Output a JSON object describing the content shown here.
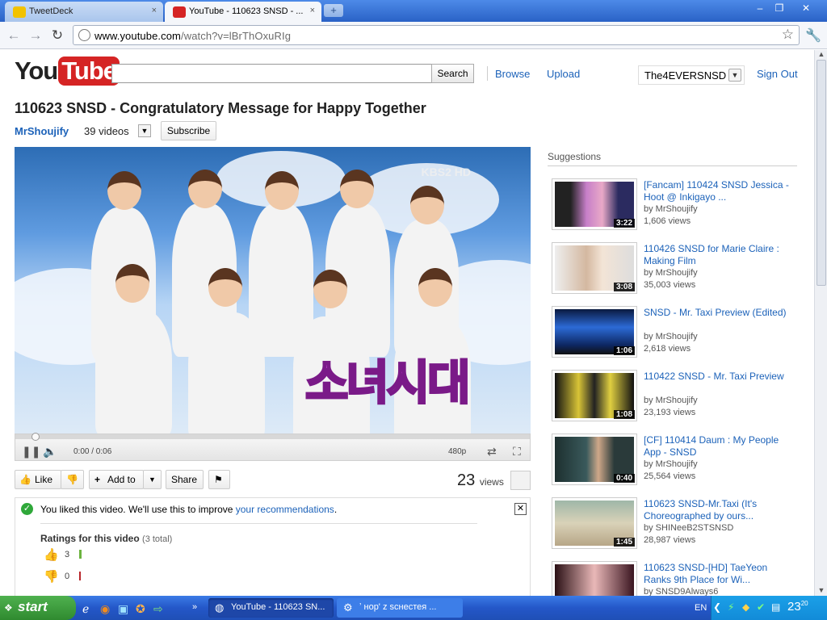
{
  "browser": {
    "tabs": [
      {
        "title": "TweetDeck",
        "close": "×"
      },
      {
        "title": "YouTube - 110623 SNSD - ...",
        "close": "×"
      }
    ],
    "new_tab": "+",
    "window_controls": [
      "–",
      "❐",
      "✕"
    ],
    "url_host": "www.youtube.com",
    "url_path": "/watch?v=lBrThOxuRIg"
  },
  "header": {
    "logo_you": "You",
    "logo_tube": "Tube",
    "search_placeholder": "",
    "search_button": "Search",
    "browse": "Browse",
    "upload": "Upload",
    "username": "The4EVERSNSD",
    "sign_out": "Sign Out"
  },
  "video": {
    "title": "110623 SNSD - Congratulatory Message for Happy Together",
    "channel": "MrShoujify",
    "video_count": "39 videos",
    "subscribe": "Subscribe",
    "broadcaster": "KBS2 HD",
    "overlay_text": "소녀시대",
    "time": "0:00 / 0:06",
    "quality": "480p",
    "played_fraction": 0.0
  },
  "actions": {
    "like": "Like",
    "add_to": "Add to",
    "share": "Share",
    "views_count": "23",
    "views_label": "views"
  },
  "liked_panel": {
    "message_prefix": "You liked this video. We'll use this to improve ",
    "message_link": "your recommendations",
    "message_suffix": ".",
    "ratings_title": "Ratings for this video",
    "ratings_total": "(3 total)",
    "likes": "3",
    "dislikes": "0",
    "like_color": "#6cb33f",
    "dislike_color": "#b8252a"
  },
  "suggestions": {
    "heading": "Suggestions",
    "items": [
      {
        "title": "[Fancam] 110424 SNSD Jessica - Hoot @ Inkigayo ...",
        "by": "by MrShoujify",
        "views": "1,606 views",
        "duration": "3:22"
      },
      {
        "title": "110426 SNSD for Marie Claire : Making Film",
        "by": "by MrShoujify",
        "views": "35,003 views",
        "duration": "3:08"
      },
      {
        "title": "SNSD - Mr. Taxi Preview (Edited)",
        "by": "by MrShoujify",
        "views": "2,618 views",
        "duration": "1:06"
      },
      {
        "title": "110422 SNSD - Mr. Taxi Preview",
        "by": "by MrShoujify",
        "views": "23,193 views",
        "duration": "1:08"
      },
      {
        "title": "[CF] 110414 Daum : My People App - SNSD",
        "by": "by MrShoujify",
        "views": "25,564 views",
        "duration": "0:40"
      },
      {
        "title": "110623 SNSD-Mr.Taxi (It's Choreographed by ours...",
        "by": "by SHINeeB2STSNSD",
        "views": "28,987 views",
        "duration": "1:45"
      },
      {
        "title": "110623 SNSD-[HD] TaeYeon Ranks 9th Place for Wi...",
        "by": "by SNSD9Always6",
        "views": "",
        "duration": ""
      }
    ]
  },
  "taskbar": {
    "start": "start",
    "tasks": [
      {
        "label": "YouTube - 110623 SN..."
      },
      {
        "label": "ʼ    нор' z scнестея ..."
      }
    ],
    "language": "EN",
    "clock": "23",
    "clock_min": "20"
  }
}
